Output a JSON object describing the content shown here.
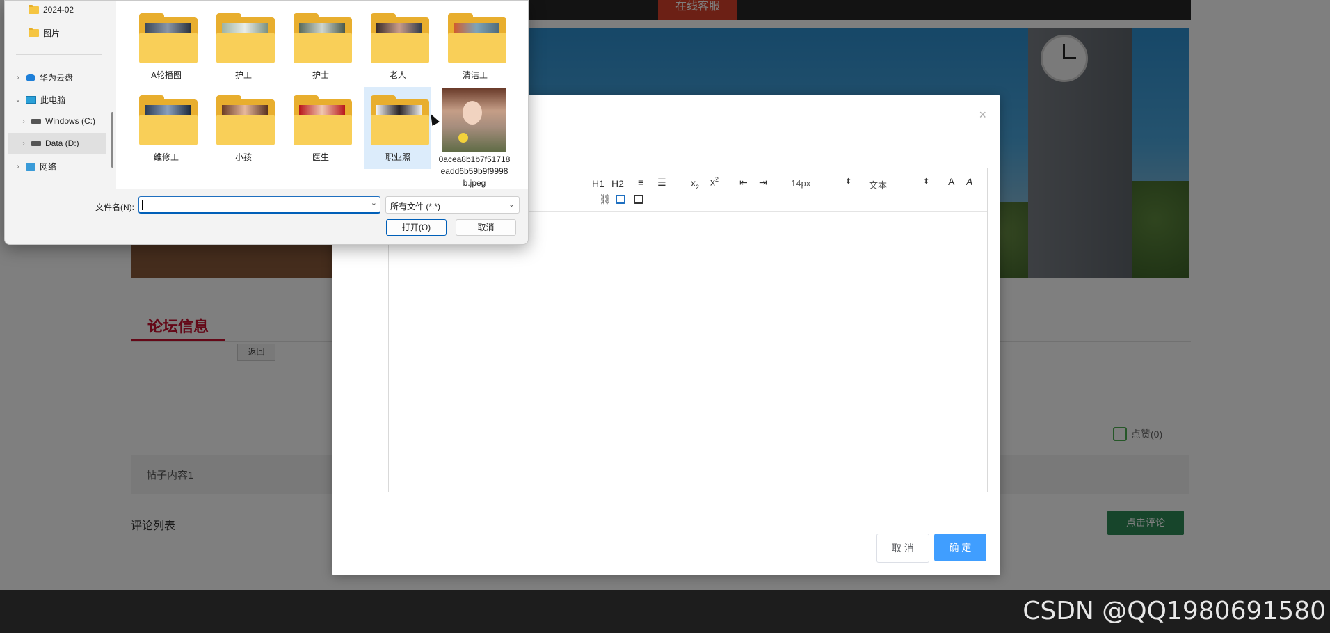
{
  "site": {
    "nav": {
      "service_label": "在线客服"
    },
    "forum": {
      "section_title": "论坛信息",
      "back_label": "返回",
      "like_label": "点赞(0)",
      "post_content": "帖子内容1",
      "comment_list_label": "评论列表",
      "comment_button_label": "点击评论"
    }
  },
  "editor_modal": {
    "close_glyph": "×",
    "toolbar": {
      "h1": "H1",
      "h2": "H2",
      "font_size": "14px",
      "paragraph": "文本"
    },
    "cancel_label": "取 消",
    "confirm_label": "确 定"
  },
  "file_dialog": {
    "nav": [
      {
        "label": "2024-02",
        "icon": "folder-icon"
      },
      {
        "label": "图片",
        "icon": "folder-icon"
      },
      {
        "label": "华为云盘",
        "icon": "cloud-icon"
      },
      {
        "label": "此电脑",
        "icon": "pc-icon"
      },
      {
        "label": "Windows (C:)",
        "icon": "drive-icon"
      },
      {
        "label": "Data (D:)",
        "icon": "drive-icon",
        "selected": true
      },
      {
        "label": "网络",
        "icon": "network-icon"
      }
    ],
    "items": [
      {
        "label": "A轮播图",
        "type": "folder"
      },
      {
        "label": "护工",
        "type": "folder"
      },
      {
        "label": "护士",
        "type": "folder"
      },
      {
        "label": "老人",
        "type": "folder"
      },
      {
        "label": "清洁工",
        "type": "folder"
      },
      {
        "label": "维修工",
        "type": "folder"
      },
      {
        "label": "小孩",
        "type": "folder"
      },
      {
        "label": "医生",
        "type": "folder"
      },
      {
        "label": "职业照",
        "type": "folder",
        "hovered": true
      },
      {
        "label": "0acea8b1b7f51718eadd6b59b9f9998b.jpeg",
        "type": "image"
      }
    ],
    "filename_label": "文件名(N):",
    "filename_value": "",
    "filetype_value": "所有文件 (*.*)",
    "open_label": "打开(O)",
    "cancel_label": "取消"
  },
  "watermark": "CSDN @QQ1980691580",
  "colors": {
    "accent_red": "#c8102e",
    "primary_blue": "#409eff",
    "comment_green": "#2e8b57",
    "dialog_focus": "#005fb8"
  }
}
